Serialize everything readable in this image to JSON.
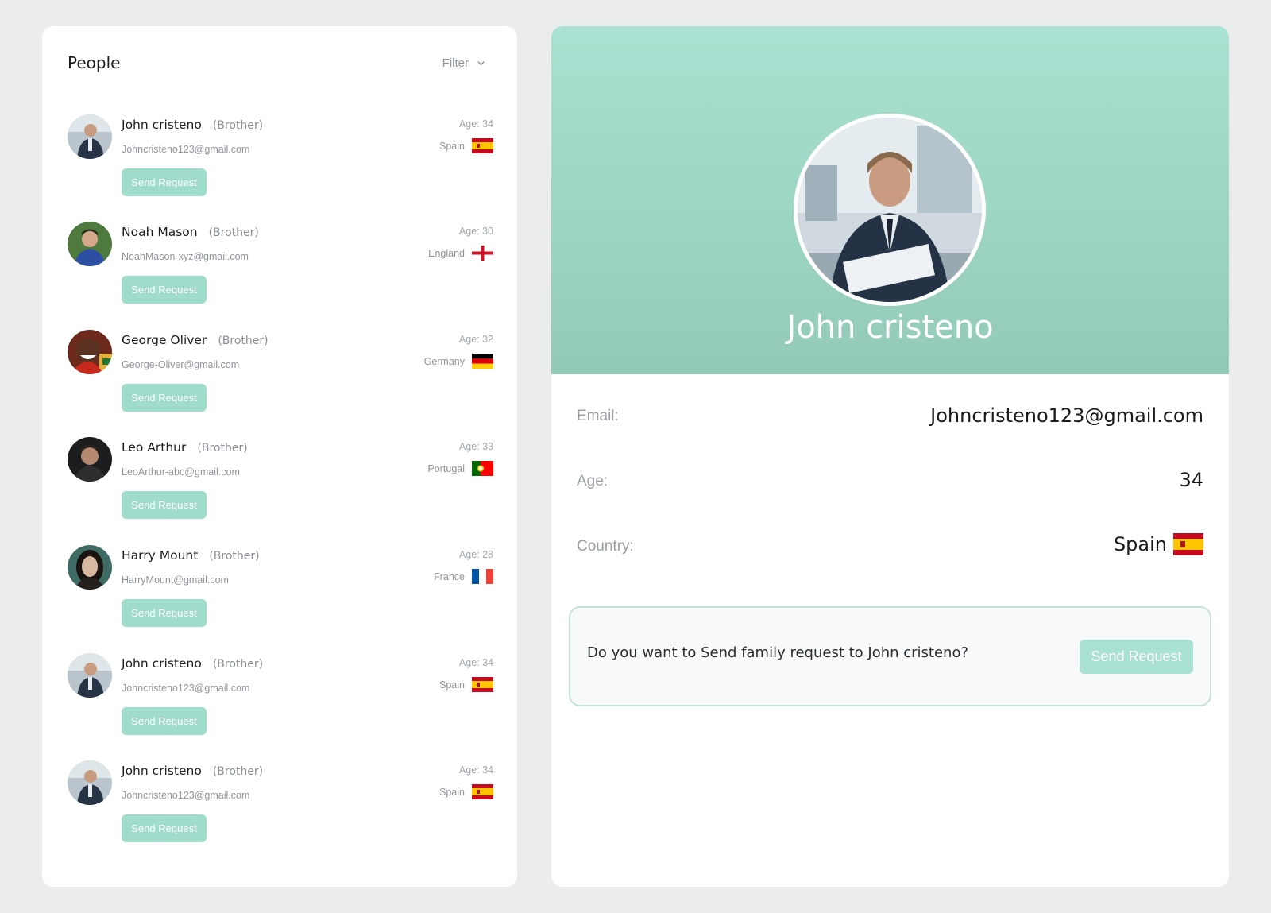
{
  "people_panel": {
    "title": "People",
    "filter_label": "Filter",
    "people": [
      {
        "name": "John cristeno",
        "relation": "(Brother)",
        "email": "Johncristeno123@gmail.com",
        "age": "Age: 34",
        "country": "Spain",
        "flag": "spain-flag-icon",
        "button": "Send Request"
      },
      {
        "name": "Noah Mason",
        "relation": "(Brother)",
        "email": "NoahMason-xyz@gmail.com",
        "age": "Age: 30",
        "country": "England",
        "flag": "england-flag-icon",
        "button": "Send Request"
      },
      {
        "name": "George Oliver",
        "relation": "(Brother)",
        "email": "George-Oliver@gmail.com",
        "age": "Age: 32",
        "country": "Germany",
        "flag": "germany-flag-icon",
        "button": "Send Request"
      },
      {
        "name": "Leo Arthur",
        "relation": "(Brother)",
        "email": "LeoArthur-abc@gmail.com",
        "age": "Age: 33",
        "country": "Portugal",
        "flag": "portugal-flag-icon",
        "button": "Send Request"
      },
      {
        "name": "Harry Mount",
        "relation": "(Brother)",
        "email": "HarryMount@gmail.com",
        "age": "Age: 28",
        "country": "France",
        "flag": "france-flag-icon",
        "button": "Send Request"
      },
      {
        "name": "John cristeno",
        "relation": "(Brother)",
        "email": "Johncristeno123@gmail.com",
        "age": "Age: 34",
        "country": "Spain",
        "flag": "spain-flag-icon",
        "button": "Send Request"
      },
      {
        "name": "John cristeno",
        "relation": "(Brother)",
        "email": "Johncristeno123@gmail.com",
        "age": "Age: 34",
        "country": "Spain",
        "flag": "spain-flag-icon",
        "button": "Send Request"
      }
    ]
  },
  "detail": {
    "name": "John cristeno",
    "email_label": "Email:",
    "email_value": "Johncristeno123@gmail.com",
    "age_label": "Age:",
    "age_value": "34",
    "country_label": "Country:",
    "country_value": "Spain",
    "country_flag": "spain-flag-icon",
    "request_prompt": "Do you want to Send family request to John cristeno?",
    "request_button": "Send Request"
  },
  "colors": {
    "accent": "#9fdccb",
    "hero_top": "#a9e2d2",
    "hero_bottom": "#93cab7",
    "page_bg": "#ebecee"
  }
}
